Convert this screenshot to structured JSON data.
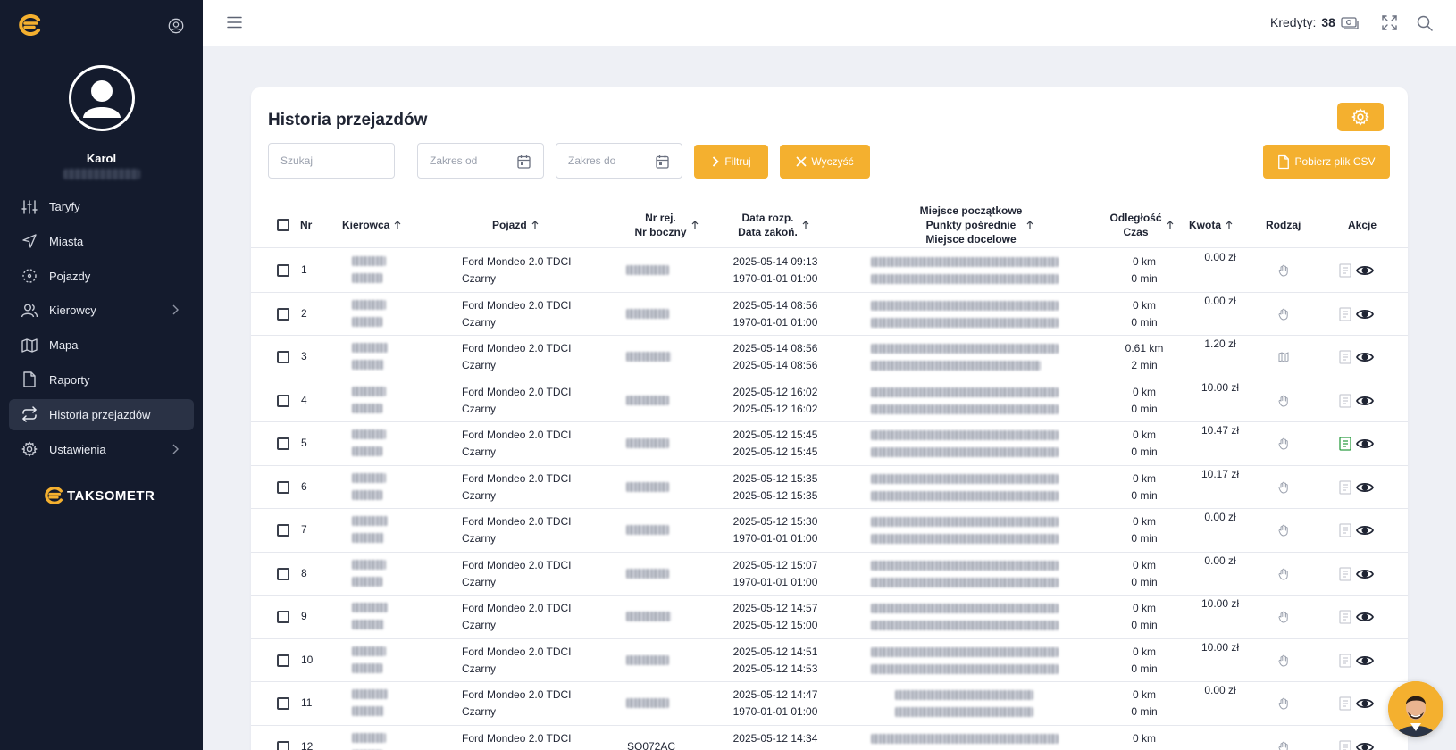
{
  "sidebar": {
    "user": {
      "name": "Karol"
    },
    "items": [
      {
        "label": "Taryfy",
        "icon": "sliders-icon"
      },
      {
        "label": "Miasta",
        "icon": "navigation-icon"
      },
      {
        "label": "Pojazdy",
        "icon": "vehicle-icon"
      },
      {
        "label": "Kierowcy",
        "icon": "users-icon"
      },
      {
        "label": "Mapa",
        "icon": "map-icon"
      },
      {
        "label": "Raporty",
        "icon": "file-icon"
      },
      {
        "label": "Historia przejazdów",
        "icon": "repeat-icon"
      },
      {
        "label": "Ustawienia",
        "icon": "gear-icon"
      }
    ],
    "brand": "TAKSOMETR"
  },
  "topbar": {
    "credits_label": "Kredyty:",
    "credits_value": "38"
  },
  "page": {
    "title": "Historia przejazdów",
    "search_placeholder": "Szukaj",
    "date_from_placeholder": "Zakres od",
    "date_to_placeholder": "Zakres do",
    "filter_label": "Filtruj",
    "clear_label": "Wyczyść",
    "csv_label": "Pobierz plik CSV"
  },
  "table": {
    "headers": {
      "nr": "Nr",
      "driver": "Kierowca",
      "vehicle": "Pojazd",
      "reg1": "Nr rej.",
      "reg2": "Nr boczny",
      "date1": "Data rozp.",
      "date2": "Data zakoń.",
      "place1": "Miejsce początkowe",
      "place2": "Punkty pośrednie",
      "place3": "Miejsce docelowe",
      "dist1": "Odległość",
      "dist2": "Czas",
      "amount": "Kwota",
      "kind": "Rodzaj",
      "actions": "Akcje"
    },
    "rows": [
      {
        "nr": "1",
        "vehicle": "Ford Mondeo 2.0 TDCI",
        "color": "Czarny",
        "start": "2025-05-14 09:13",
        "end": "1970-01-01 01:00",
        "dist": "0 km",
        "time": "0 min",
        "amount": "0.00 zł",
        "kind": "hand",
        "doc_active": false
      },
      {
        "nr": "2",
        "vehicle": "Ford Mondeo 2.0 TDCI",
        "color": "Czarny",
        "start": "2025-05-14 08:56",
        "end": "1970-01-01 01:00",
        "dist": "0 km",
        "time": "0 min",
        "amount": "0.00 zł",
        "kind": "hand",
        "doc_active": false
      },
      {
        "nr": "3",
        "vehicle": "Ford Mondeo 2.0 TDCI",
        "color": "Czarny",
        "start": "2025-05-14 08:56",
        "end": "2025-05-14 08:56",
        "dist": "0.61 km",
        "time": "2 min",
        "amount": "1.20 zł",
        "kind": "map",
        "doc_active": false
      },
      {
        "nr": "4",
        "vehicle": "Ford Mondeo 2.0 TDCI",
        "color": "Czarny",
        "start": "2025-05-12 16:02",
        "end": "2025-05-12 16:02",
        "dist": "0 km",
        "time": "0 min",
        "amount": "10.00 zł",
        "kind": "hand",
        "doc_active": false
      },
      {
        "nr": "5",
        "vehicle": "Ford Mondeo 2.0 TDCI",
        "color": "Czarny",
        "start": "2025-05-12 15:45",
        "end": "2025-05-12 15:45",
        "dist": "0 km",
        "time": "0 min",
        "amount": "10.47 zł",
        "kind": "hand",
        "doc_active": true
      },
      {
        "nr": "6",
        "vehicle": "Ford Mondeo 2.0 TDCI",
        "color": "Czarny",
        "start": "2025-05-12 15:35",
        "end": "2025-05-12 15:35",
        "dist": "0 km",
        "time": "0 min",
        "amount": "10.17 zł",
        "kind": "hand",
        "doc_active": false
      },
      {
        "nr": "7",
        "vehicle": "Ford Mondeo 2.0 TDCI",
        "color": "Czarny",
        "start": "2025-05-12 15:30",
        "end": "1970-01-01 01:00",
        "dist": "0 km",
        "time": "0 min",
        "amount": "0.00 zł",
        "kind": "hand",
        "doc_active": false
      },
      {
        "nr": "8",
        "vehicle": "Ford Mondeo 2.0 TDCI",
        "color": "Czarny",
        "start": "2025-05-12 15:07",
        "end": "1970-01-01 01:00",
        "dist": "0 km",
        "time": "0 min",
        "amount": "0.00 zł",
        "kind": "hand",
        "doc_active": false
      },
      {
        "nr": "9",
        "vehicle": "Ford Mondeo 2.0 TDCI",
        "color": "Czarny",
        "start": "2025-05-12 14:57",
        "end": "2025-05-12 15:00",
        "dist": "0 km",
        "time": "0 min",
        "amount": "10.00 zł",
        "kind": "hand",
        "doc_active": false
      },
      {
        "nr": "10",
        "vehicle": "Ford Mondeo 2.0 TDCI",
        "color": "Czarny",
        "start": "2025-05-12 14:51",
        "end": "2025-05-12 14:53",
        "dist": "0 km",
        "time": "0 min",
        "amount": "10.00 zł",
        "kind": "hand",
        "doc_active": false
      },
      {
        "nr": "11",
        "vehicle": "Ford Mondeo 2.0 TDCI",
        "color": "Czarny",
        "start": "2025-05-12 14:47",
        "end": "1970-01-01 01:00",
        "dist": "0 km",
        "time": "0 min",
        "amount": "0.00 zł",
        "kind": "hand",
        "doc_active": false
      },
      {
        "nr": "12",
        "vehicle": "Ford Mondeo 2.0 TDCI",
        "color": "",
        "reg": "SO072AC",
        "start": "2025-05-12 14:34",
        "end": "",
        "dist": "0 km",
        "time": "",
        "amount": "",
        "kind": "hand",
        "doc_active": false
      }
    ]
  },
  "colors": {
    "accent": "#f4b02f",
    "sidebar": "#141b2d",
    "active_doc": "#2e9e44"
  }
}
